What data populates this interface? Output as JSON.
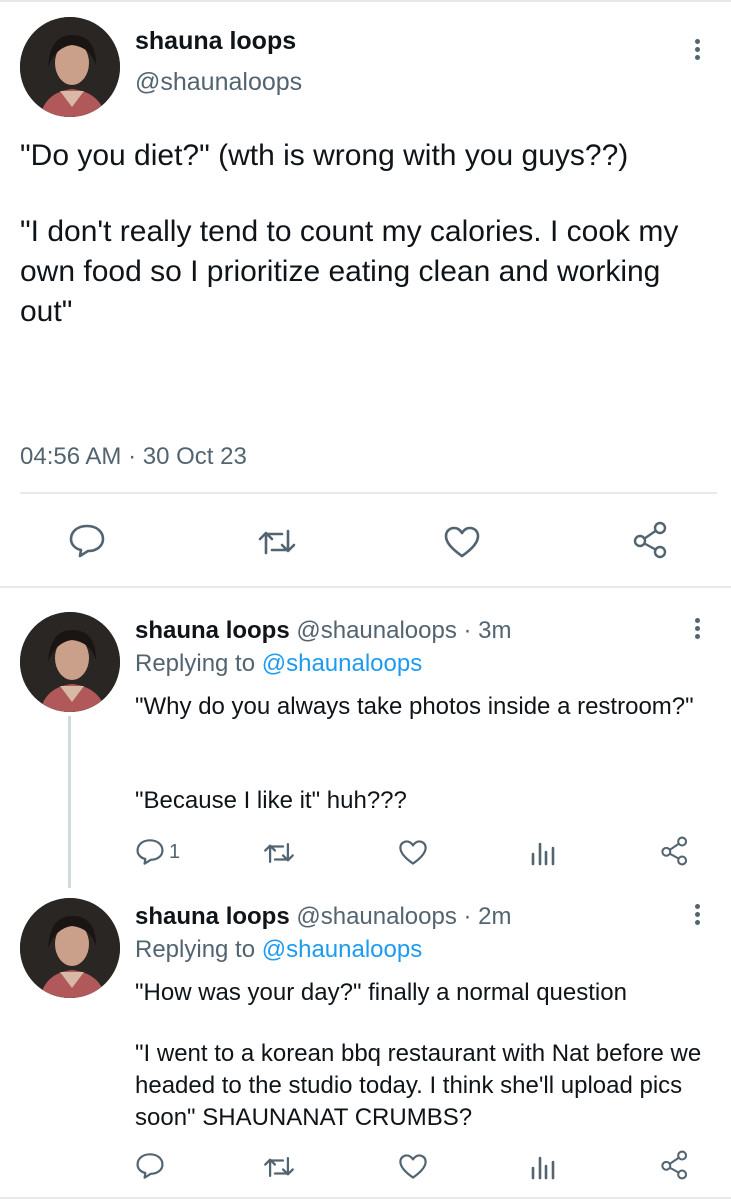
{
  "main_tweet": {
    "display_name": "shauna loops",
    "handle": "@shaunaloops",
    "text_line1": "\"Do you diet?\" (wth is wrong with you guys??)",
    "text_para2": "\"I don't really tend to count my calories. I cook my own food so I prioritize eating clean and working out\"",
    "timestamp": "04:56 AM · 30 Oct 23",
    "actions": [
      "reply-icon",
      "retweet-icon",
      "like-icon",
      "share-icon"
    ]
  },
  "replies": [
    {
      "display_name": "shauna loops",
      "handle_time": "@shaunaloops · 3m",
      "replying_prefix": "Replying to ",
      "replying_to": "@shaunaloops",
      "text_para1": "\"Why do you always take photos inside a restroom?\"",
      "text_para2": "\"Because I like it\" huh???",
      "reply_count": "1"
    },
    {
      "display_name": "shauna loops",
      "handle_time": "@shaunaloops · 2m",
      "replying_prefix": "Replying to ",
      "replying_to": "@shaunaloops",
      "text_para1": "\"How was your day?\" finally a normal question",
      "text_para2": "\"I went to a korean bbq restaurant with Nat before we headed to the studio today. I think she'll upload pics soon\" SHAUNANAT CRUMBS?",
      "reply_count": ""
    }
  ],
  "colors": {
    "accent": "#1d9bf0",
    "secondary_text": "#536471",
    "divider": "#e7e9eb"
  }
}
